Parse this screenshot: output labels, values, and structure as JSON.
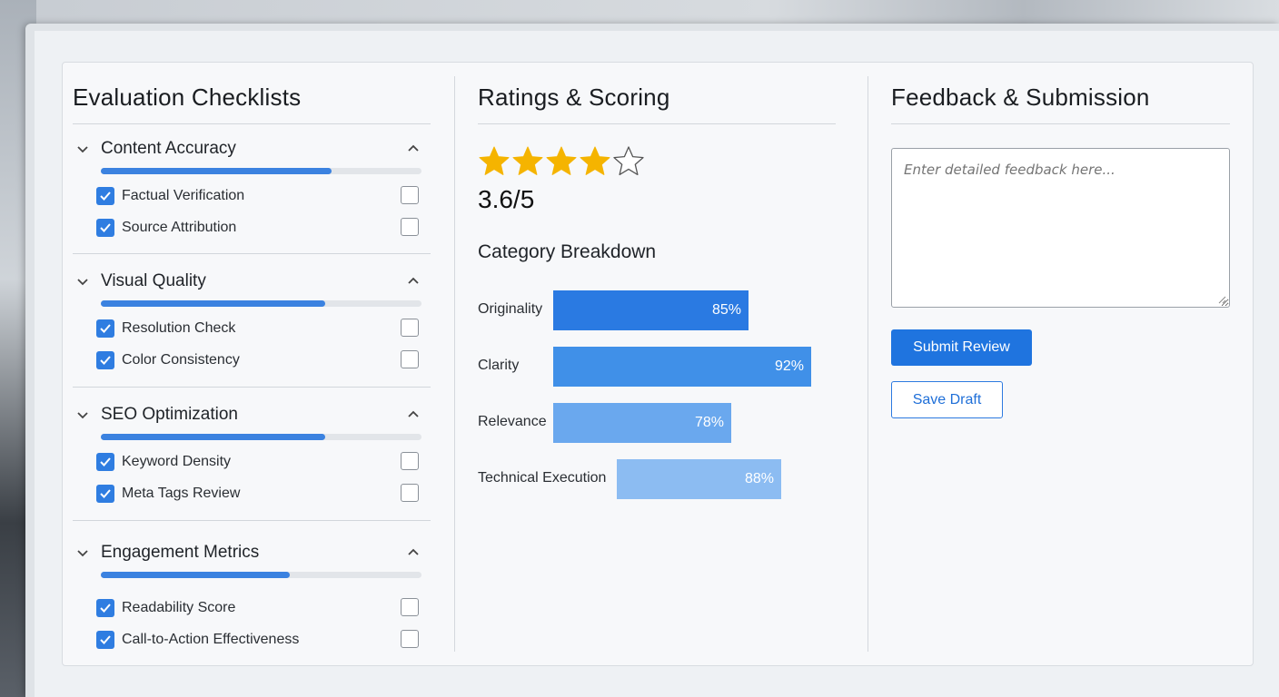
{
  "checklists": {
    "title": "Evaluation Checklists",
    "sections": [
      {
        "title": "Content Accuracy",
        "progress": 0.72,
        "items": [
          {
            "label": "Factual Verification",
            "checked": true
          },
          {
            "label": "Source Attribution",
            "checked": true
          }
        ]
      },
      {
        "title": "Visual Quality",
        "progress": 0.7,
        "items": [
          {
            "label": "Resolution Check",
            "checked": true
          },
          {
            "label": "Color Consistency",
            "checked": true
          }
        ]
      },
      {
        "title": "SEO Optimization",
        "progress": 0.7,
        "items": [
          {
            "label": "Keyword Density",
            "checked": true
          },
          {
            "label": "Meta Tags Review",
            "checked": true
          }
        ]
      },
      {
        "title": "Engagement Metrics",
        "progress": 0.59,
        "items": [
          {
            "label": "Readability Score",
            "checked": true
          },
          {
            "label": "Call-to-Action Effectiveness",
            "checked": true
          }
        ]
      }
    ]
  },
  "ratings": {
    "title": "Ratings & Scoring",
    "stars_filled": 4,
    "stars_total": 5,
    "score_text": "3.6/5",
    "breakdown_title": "Category Breakdown",
    "categories": [
      {
        "label": "Originality",
        "value": 85,
        "value_text": "85%",
        "color": "#2a7ae2"
      },
      {
        "label": "Clarity",
        "value": 92,
        "value_text": "92%",
        "color": "#4090e8"
      },
      {
        "label": "Relevance",
        "value": 78,
        "value_text": "78%",
        "color": "#6aa8ee"
      },
      {
        "label": "Technical Execution",
        "value": 88,
        "value_text": "88%",
        "color": "#8cbcf2"
      }
    ]
  },
  "feedback": {
    "title": "Feedback & Submission",
    "placeholder": "Enter detailed feedback here...",
    "submit_label": "Submit Review",
    "draft_label": "Save Draft"
  },
  "colors": {
    "accent": "#2f7de1",
    "star": "#f5b400"
  }
}
